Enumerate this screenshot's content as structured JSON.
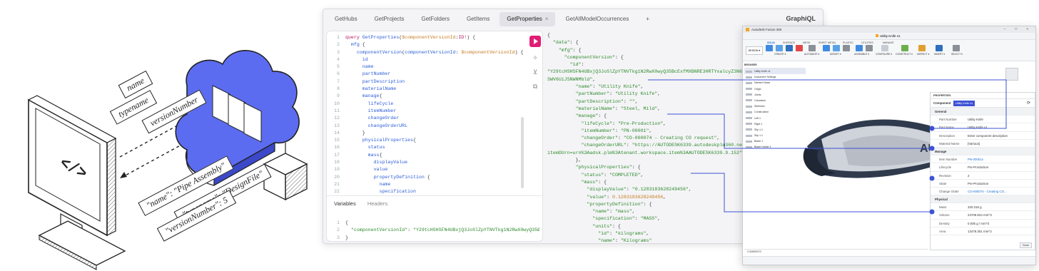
{
  "illustration": {
    "tags_top": [
      "name",
      "typename",
      "versionNumber"
    ],
    "tags_bottom": [
      "\"name\": \"Pipe Assembly\"",
      "\"typename\": \"DesignFile\"",
      "\"versionNumber\": 5"
    ]
  },
  "graphiql": {
    "tabs": [
      {
        "label": "GetHubs",
        "active": false
      },
      {
        "label": "GetProjects",
        "active": false
      },
      {
        "label": "GetFolders",
        "active": false
      },
      {
        "label": "GetItems",
        "active": false
      },
      {
        "label": "GetProperties",
        "active": true
      },
      {
        "label": "GetAllModelOccurrences",
        "active": false
      }
    ],
    "close_glyph": "×",
    "add_tab": "+",
    "brand": "GraphiQL",
    "query_lines": [
      {
        "n": "1",
        "t": [
          [
            "k",
            "query "
          ],
          [
            "f",
            "GetProperties"
          ],
          [
            "p",
            "("
          ],
          [
            "v",
            "$componentVersionId"
          ],
          [
            "p",
            ":"
          ],
          [
            "k",
            "ID!"
          ],
          [
            "p",
            ") {"
          ]
        ]
      },
      {
        "n": "2",
        "t": [
          [
            "p",
            "  "
          ],
          [
            "f",
            "mfg"
          ],
          [
            "p",
            " {"
          ]
        ]
      },
      {
        "n": "3",
        "t": [
          [
            "p",
            "    "
          ],
          [
            "f",
            "componentVersion"
          ],
          [
            "p",
            "("
          ],
          [
            "f",
            "componentVersionId"
          ],
          [
            "p",
            ": "
          ],
          [
            "v",
            "$componentVersionId"
          ],
          [
            "p",
            ") {"
          ]
        ]
      },
      {
        "n": "4",
        "t": [
          [
            "p",
            "      "
          ],
          [
            "f",
            "id"
          ]
        ]
      },
      {
        "n": "5",
        "t": [
          [
            "p",
            "      "
          ],
          [
            "f",
            "name"
          ]
        ]
      },
      {
        "n": "6",
        "t": [
          [
            "p",
            "      "
          ],
          [
            "f",
            "partNumber"
          ]
        ]
      },
      {
        "n": "7",
        "t": [
          [
            "p",
            "      "
          ],
          [
            "f",
            "partDescription"
          ]
        ]
      },
      {
        "n": "8",
        "t": [
          [
            "p",
            "      "
          ],
          [
            "f",
            "materialName"
          ]
        ]
      },
      {
        "n": "9",
        "t": [
          [
            "p",
            "      "
          ],
          [
            "f",
            "manage"
          ],
          [
            "p",
            "{"
          ]
        ]
      },
      {
        "n": "10",
        "t": [
          [
            "p",
            "        "
          ],
          [
            "f",
            "lifeCycle"
          ]
        ]
      },
      {
        "n": "11",
        "t": [
          [
            "p",
            "        "
          ],
          [
            "f",
            "itemNumber"
          ]
        ]
      },
      {
        "n": "12",
        "t": [
          [
            "p",
            "        "
          ],
          [
            "f",
            "changeOrder"
          ]
        ]
      },
      {
        "n": "13",
        "t": [
          [
            "p",
            "        "
          ],
          [
            "f",
            "changeOrderURL"
          ]
        ]
      },
      {
        "n": "14",
        "t": [
          [
            "p",
            "      }"
          ]
        ]
      },
      {
        "n": "15",
        "t": [
          [
            "p",
            "      "
          ],
          [
            "f",
            "physicalProperties"
          ],
          [
            "p",
            "{"
          ]
        ]
      },
      {
        "n": "16",
        "t": [
          [
            "p",
            "        "
          ],
          [
            "f",
            "status"
          ]
        ]
      },
      {
        "n": "17",
        "t": [
          [
            "p",
            "        "
          ],
          [
            "f",
            "mass"
          ],
          [
            "p",
            "{"
          ]
        ]
      },
      {
        "n": "18",
        "t": [
          [
            "p",
            "          "
          ],
          [
            "f",
            "displayValue"
          ]
        ]
      },
      {
        "n": "19",
        "t": [
          [
            "p",
            "          "
          ],
          [
            "f",
            "value"
          ]
        ]
      },
      {
        "n": "20",
        "t": [
          [
            "p",
            "          "
          ],
          [
            "f",
            "propertyDefinition"
          ],
          [
            "p",
            " {"
          ]
        ]
      },
      {
        "n": "21",
        "t": [
          [
            "p",
            "            "
          ],
          [
            "f",
            "name"
          ]
        ]
      },
      {
        "n": "22",
        "t": [
          [
            "p",
            "            "
          ],
          [
            "f",
            "specification"
          ]
        ]
      }
    ],
    "variables_tabs": [
      "Variables",
      "Headers"
    ],
    "variables_lines": [
      {
        "n": "1",
        "t": [
          [
            "p",
            "{"
          ]
        ]
      },
      {
        "n": "2",
        "t": [
          [
            "p",
            "  "
          ],
          [
            "s",
            "\"componentVersionId\""
          ],
          [
            "p",
            ": "
          ],
          [
            "s",
            "\"Y29tcHSHSFN4UBxjQ3JoSlZpYTNVTkg1N2RwX0wyQ35Ø"
          ]
        ]
      },
      {
        "n": "3",
        "t": [
          [
            "p",
            "}"
          ]
        ]
      }
    ],
    "response_lines": [
      [
        [
          "p",
          "{"
        ]
      ],
      [
        [
          "p",
          "  "
        ],
        [
          "s",
          "\"data\""
        ],
        [
          "p",
          ": {"
        ]
      ],
      [
        [
          "p",
          "    "
        ],
        [
          "s",
          "\"mfg\""
        ],
        [
          "p",
          ": {"
        ]
      ],
      [
        [
          "p",
          "      "
        ],
        [
          "s",
          "\"componentVersion\""
        ],
        [
          "p",
          ": {"
        ]
      ],
      [
        [
          "p",
          "        "
        ],
        [
          "s",
          "\"id\""
        ],
        [
          "p",
          ":"
        ]
      ],
      [
        [
          "s",
          "\"Y29tcHSHSFN4UBxjQ3JoSlZpYTNVTkg1N2RwX0wyQ35BcExfMXBNRE3HRTYxalcyZ3N6"
        ]
      ],
      [
        [
          "s",
          "SWV6UiJ5NWNMbld\""
        ],
        [
          "p",
          ","
        ]
      ],
      [
        [
          "p",
          "          "
        ],
        [
          "s",
          "\"name\""
        ],
        [
          "p",
          ": "
        ],
        [
          "s",
          "\"Utility Knife\""
        ],
        [
          "p",
          ","
        ]
      ],
      [
        [
          "p",
          "          "
        ],
        [
          "s",
          "\"partNumber\""
        ],
        [
          "p",
          ": "
        ],
        [
          "s",
          "\"Utility Knife\""
        ],
        [
          "p",
          ","
        ]
      ],
      [
        [
          "p",
          "          "
        ],
        [
          "s",
          "\"partDescription\""
        ],
        [
          "p",
          ": "
        ],
        [
          "s",
          "\"\""
        ],
        [
          "p",
          ","
        ]
      ],
      [
        [
          "p",
          "          "
        ],
        [
          "s",
          "\"materialName\""
        ],
        [
          "p",
          ": "
        ],
        [
          "s",
          "\"Steel, Mild\""
        ],
        [
          "p",
          ","
        ]
      ],
      [
        [
          "p",
          "          "
        ],
        [
          "s",
          "\"manage\""
        ],
        [
          "p",
          ": {"
        ]
      ],
      [
        [
          "p",
          "            "
        ],
        [
          "s",
          "\"lifeCycle\""
        ],
        [
          "p",
          ": "
        ],
        [
          "s",
          "\"Pre-Production\""
        ],
        [
          "p",
          ","
        ]
      ],
      [
        [
          "p",
          "            "
        ],
        [
          "s",
          "\"itemNumber\""
        ],
        [
          "p",
          ": "
        ],
        [
          "s",
          "\"PN-00001\""
        ],
        [
          "p",
          ","
        ]
      ],
      [
        [
          "p",
          "            "
        ],
        [
          "s",
          "\"changeOrder\""
        ],
        [
          "p",
          ": "
        ],
        [
          "s",
          "\"CO-000074 - Creating CO request\""
        ],
        [
          "p",
          ","
        ]
      ],
      [
        [
          "p",
          "            "
        ],
        [
          "s",
          "\"changeOrderURL\""
        ],
        [
          "p",
          ": "
        ],
        [
          "s",
          "\"https://AUTODESK6339.autodeskplm360.net/pl"
        ]
      ],
      [
        [
          "s",
          "itemDUrn=urn%3Aadsk.plm%3Atenant.workspace.item%3AAUTODESK6339.9.152\""
        ]
      ],
      [
        [
          "p",
          "          },"
        ]
      ],
      [
        [
          "p",
          "          "
        ],
        [
          "s",
          "\"physicalProperties\""
        ],
        [
          "p",
          ": {"
        ]
      ],
      [
        [
          "p",
          "            "
        ],
        [
          "s",
          "\"status\""
        ],
        [
          "p",
          ": "
        ],
        [
          "s",
          "\"COMPLETED\""
        ],
        [
          "p",
          ","
        ]
      ],
      [
        [
          "p",
          "            "
        ],
        [
          "s",
          "\"mass\""
        ],
        [
          "p",
          ": {"
        ]
      ],
      [
        [
          "p",
          "              "
        ],
        [
          "s",
          "\"displayValue\""
        ],
        [
          "p",
          ": "
        ],
        [
          "s",
          "\"0.1283183628249456\""
        ],
        [
          "p",
          ","
        ]
      ],
      [
        [
          "p",
          "              "
        ],
        [
          "s",
          "\"value\""
        ],
        [
          "p",
          ": "
        ],
        [
          "v",
          "0.1283183628249456"
        ],
        [
          "p",
          ","
        ]
      ],
      [
        [
          "p",
          "              "
        ],
        [
          "s",
          "\"propertyDefinition\""
        ],
        [
          "p",
          ": {"
        ]
      ],
      [
        [
          "p",
          "                "
        ],
        [
          "s",
          "\"name\""
        ],
        [
          "p",
          ": "
        ],
        [
          "s",
          "\"mass\""
        ],
        [
          "p",
          ","
        ]
      ],
      [
        [
          "p",
          "                "
        ],
        [
          "s",
          "\"specification\""
        ],
        [
          "p",
          ": "
        ],
        [
          "s",
          "\"MASS\""
        ],
        [
          "p",
          ","
        ]
      ],
      [
        [
          "p",
          "                "
        ],
        [
          "s",
          "\"units\""
        ],
        [
          "p",
          ": {"
        ]
      ],
      [
        [
          "p",
          "                  "
        ],
        [
          "s",
          "\"id\""
        ],
        [
          "p",
          ": "
        ],
        [
          "s",
          "\"kilograms\""
        ],
        [
          "p",
          ","
        ]
      ],
      [
        [
          "p",
          "                  "
        ],
        [
          "s",
          "\"name\""
        ],
        [
          "p",
          ": "
        ],
        [
          "s",
          "\"Kilograms\""
        ]
      ],
      [
        [
          "p",
          "                }"
        ]
      ]
    ]
  },
  "fusion": {
    "title": "Autodesk Fusion 360",
    "doc_tab": "Utility Knife v1",
    "ribbon_tabs": [
      "SOLID",
      "SURFACE",
      "MESH",
      "SHEET METAL",
      "PLASTIC",
      "UTILITIES",
      "MANAGE"
    ],
    "design_label": "DESIGN ▾",
    "ribbon_groups": [
      "CREATE ▾",
      "AUTOMATE ▾",
      "MODIFY ▾",
      "ASSEMBLE ▾",
      "CONFIGURE ▾",
      "CONSTRUCT ▾",
      "INSPECT ▾",
      "INSERT ▾",
      "SELECT ▾"
    ],
    "browser_title": "BROWSER",
    "browser_items": [
      "Utility Knife v1",
      "Document Settings",
      "Named Views",
      "Origin",
      "Joints",
      "Canvases",
      "Sketches",
      "Construction",
      "Left 1",
      "Right 1",
      "Slip 1:1",
      "Slip 1:1",
      "Blade 1",
      "Blade Holder 1"
    ],
    "properties_title": "PROPERTIES",
    "component_label": "Component",
    "component_value": "Utility Knife v1",
    "sections": [
      {
        "head": "General",
        "rows": [
          {
            "label": "Part Number",
            "value": "Utility Knife",
            "link": false
          },
          {
            "label": "Part Name",
            "value": "Utility Knife v1",
            "link": false
          },
          {
            "label": "Description",
            "value": "Enter component description",
            "link": false
          },
          {
            "label": "Material Name",
            "value": "[Various]",
            "link": false
          }
        ]
      },
      {
        "head": "Manage",
        "rows": [
          {
            "label": "Item Number",
            "value": "PN-00001x",
            "link": true
          },
          {
            "label": "Lifecycle",
            "value": "Pre-Production",
            "link": false
          },
          {
            "label": "Revision",
            "value": "2",
            "link": false
          },
          {
            "label": "State",
            "value": "Pre-Production",
            "link": false
          },
          {
            "label": "Change Order",
            "value": "CO-000074 - Creating CO...",
            "link": true
          }
        ]
      },
      {
        "head": "Physical",
        "rows": [
          {
            "label": "Mass",
            "value": "320.318 g",
            "link": false
          },
          {
            "label": "Volume",
            "value": "24709.924 mm^3",
            "link": false
          },
          {
            "label": "Density",
            "value": "0.005 g / mm^3",
            "link": false
          },
          {
            "label": "Area",
            "value": "13478.351 mm^2",
            "link": false
          }
        ]
      }
    ],
    "close_label": "Close",
    "comments_label": "COMMENTS",
    "model_text": "AUT",
    "colors": {
      "accent": "#3d52d5",
      "model_dark": "#2f3a4d",
      "model_light": "#cfd3da"
    }
  }
}
